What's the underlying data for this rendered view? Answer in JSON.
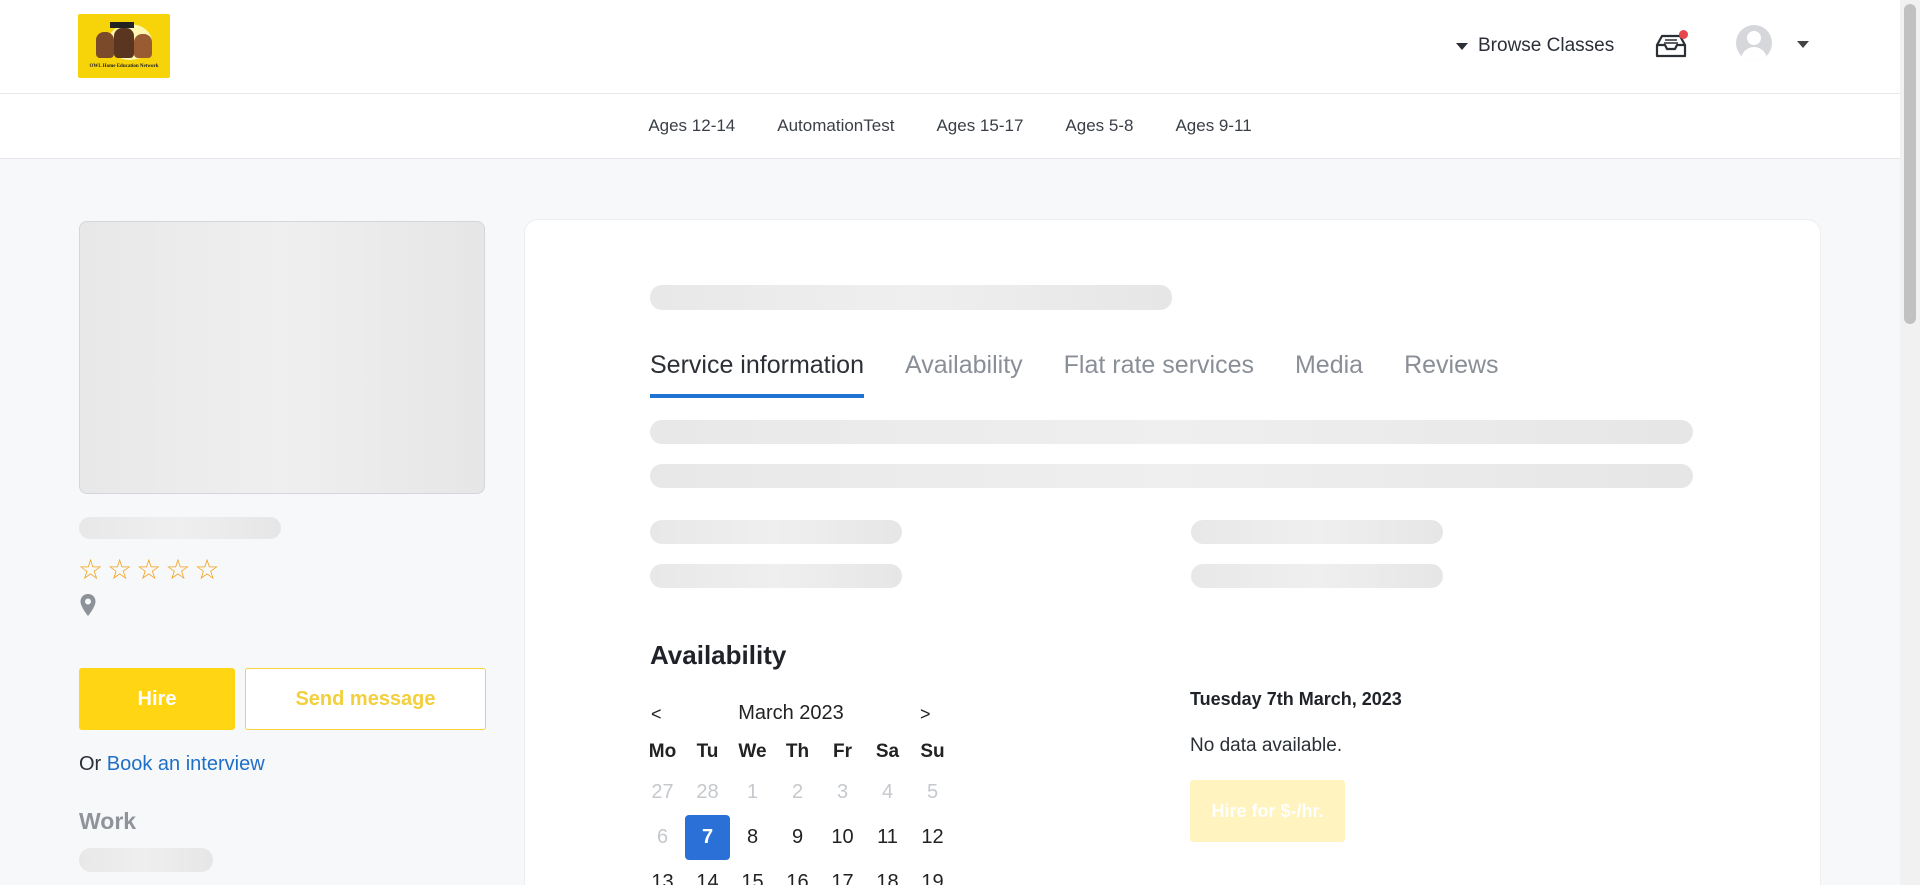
{
  "header": {
    "logo_text": "OWL Home Education Network",
    "browse_label": "Browse Classes"
  },
  "categories": [
    {
      "label": "Ages 12-14"
    },
    {
      "label": "AutomationTest"
    },
    {
      "label": "Ages 15-17"
    },
    {
      "label": "Ages 5-8"
    },
    {
      "label": "Ages 9-11"
    }
  ],
  "profile": {
    "rating_max": 5,
    "rating": 0,
    "hire_label": "Hire",
    "message_label": "Send message",
    "or_text": "Or",
    "interview_link": "Book an interview",
    "work_title": "Work"
  },
  "tabs": [
    {
      "label": "Service information",
      "active": true
    },
    {
      "label": "Availability",
      "active": false
    },
    {
      "label": "Flat rate services",
      "active": false
    },
    {
      "label": "Media",
      "active": false
    },
    {
      "label": "Reviews",
      "active": false
    }
  ],
  "availability": {
    "title": "Availability",
    "calendar": {
      "prev": "<",
      "next": ">",
      "month": "March 2023",
      "weekdays": [
        "Mo",
        "Tu",
        "We",
        "Th",
        "Fr",
        "Sa",
        "Su"
      ],
      "days": [
        {
          "d": "27",
          "out": true
        },
        {
          "d": "28",
          "out": true
        },
        {
          "d": "1",
          "out": true
        },
        {
          "d": "2",
          "out": true
        },
        {
          "d": "3",
          "out": true
        },
        {
          "d": "4",
          "out": true
        },
        {
          "d": "5",
          "out": true
        },
        {
          "d": "6",
          "out": true
        },
        {
          "d": "7",
          "sel": true
        },
        {
          "d": "8"
        },
        {
          "d": "9"
        },
        {
          "d": "10"
        },
        {
          "d": "11"
        },
        {
          "d": "12"
        },
        {
          "d": "13"
        },
        {
          "d": "14"
        },
        {
          "d": "15"
        },
        {
          "d": "16"
        },
        {
          "d": "17"
        },
        {
          "d": "18"
        },
        {
          "d": "19"
        }
      ]
    },
    "selected_date": "Tuesday 7th March, 2023",
    "no_data": "No data available.",
    "hire_rate_label": "Hire for $-/hr."
  },
  "colors": {
    "accent": "#ffd514",
    "link": "#1f6fc8",
    "tab_active": "#1f74d1",
    "selected_day": "#2b70d6",
    "star": "#f4a21a"
  }
}
